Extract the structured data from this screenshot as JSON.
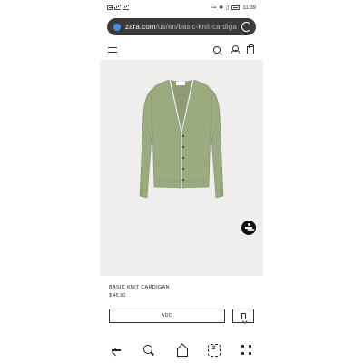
{
  "status_bar": {
    "time": "11:39"
  },
  "browser": {
    "url_host": "zara.com",
    "url_path": "/us/en/basic-knit-cardiga"
  },
  "product": {
    "name": "BASIC KNIT CARDIGAN",
    "price": "$ 45.90",
    "image_background": "#efeeec",
    "garment_color": "#9bab80"
  },
  "actions": {
    "add_label": "ADD"
  },
  "nav": {
    "tabs_count": "2"
  },
  "colors": {
    "url_bar": "#3b3b3b",
    "accessibility_button": "#111111"
  }
}
